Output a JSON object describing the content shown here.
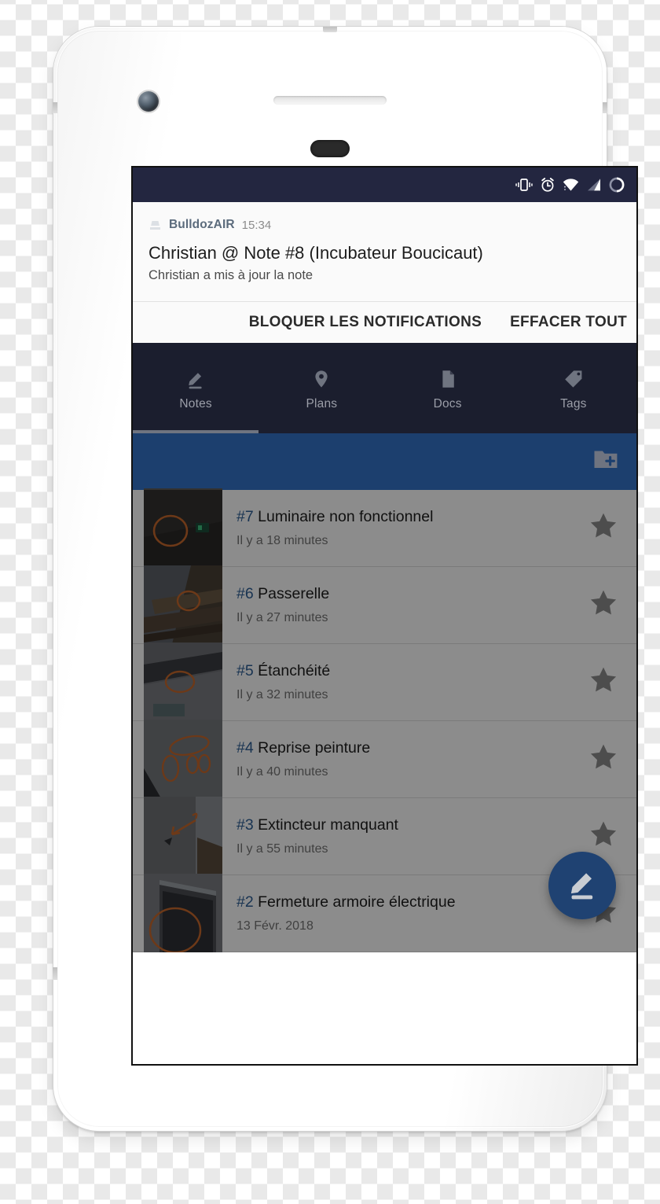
{
  "statusbar": {
    "icons": [
      "vibrate-icon",
      "alarm-icon",
      "wifi-icon",
      "signal-icon",
      "battery-icon"
    ],
    "background_color": "#232640"
  },
  "notification": {
    "app_icon": "bulldozair-app-icon",
    "app_name": "BulldozAIR",
    "time": "15:34",
    "title": "Christian @ Note #8 (Incubateur Boucicaut)",
    "body": "Christian a mis à jour la note",
    "actions": {
      "block": "BLOQUER LES NOTIFICATIONS",
      "clear_all": "EFFACER TOUT"
    }
  },
  "tabs": [
    {
      "label": "Notes",
      "icon": "pencil-icon",
      "active": true
    },
    {
      "label": "Plans",
      "icon": "map-pin-icon",
      "active": false
    },
    {
      "label": "Docs",
      "icon": "document-icon",
      "active": false
    },
    {
      "label": "Tags",
      "icon": "tag-icon",
      "active": false
    }
  ],
  "action_bar": {
    "background_color": "#1c3f6e",
    "new_folder_icon": "folder-plus-icon"
  },
  "notes": [
    {
      "number": "#7",
      "title": "Luminaire non fonctionnel",
      "subtitle": "Il y a 18 minutes",
      "starred": false
    },
    {
      "number": "#6",
      "title": "Passerelle",
      "subtitle": "Il y a 27 minutes",
      "starred": false
    },
    {
      "number": "#5",
      "title": "Étanchéité",
      "subtitle": "Il y a 32 minutes",
      "starred": false
    },
    {
      "number": "#4",
      "title": "Reprise peinture",
      "subtitle": "Il y a 40 minutes",
      "starred": false
    },
    {
      "number": "#3",
      "title": "Extincteur manquant",
      "subtitle": "Il y a 55 minutes",
      "starred": false
    },
    {
      "number": "#2",
      "title": "Fermeture armoire électrique",
      "subtitle": "13 Févr. 2018",
      "starred": false
    }
  ],
  "fab": {
    "icon": "edit-pencil-icon",
    "color": "#1f4272"
  },
  "colors": {
    "accent_blue": "#2e5f96",
    "toolbar_blue": "#1c3f6e",
    "dark_navy": "#1b1e2e",
    "status_navy": "#232640"
  }
}
